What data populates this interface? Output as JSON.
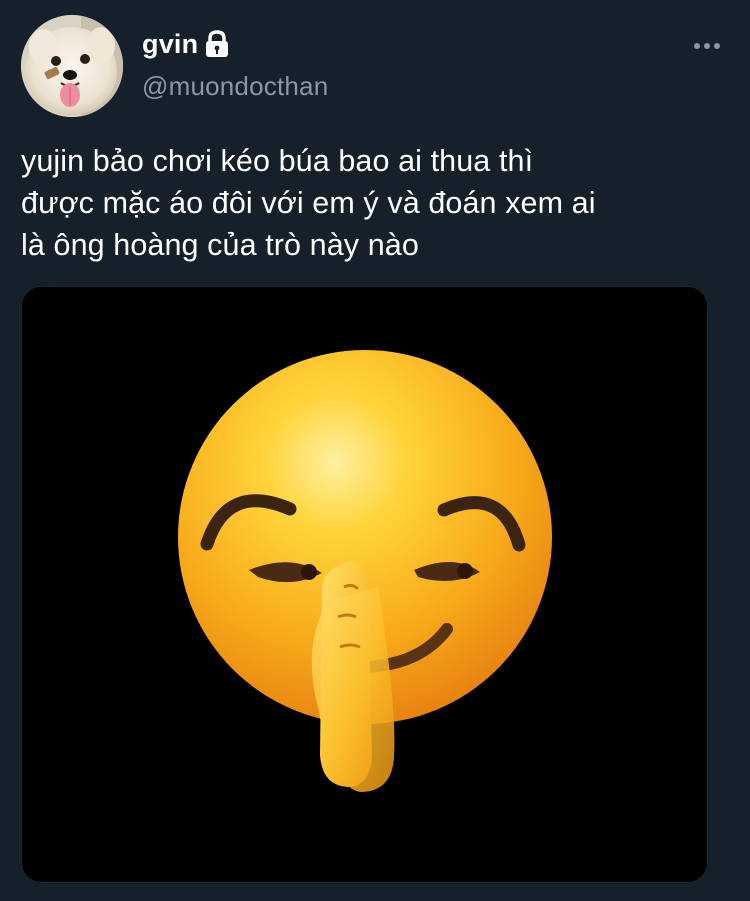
{
  "author": {
    "display_name": "gvin",
    "handle": "@muondocthan",
    "avatar": "white-puppy-photo",
    "protected_icon": "lock-icon"
  },
  "tweet": {
    "text_lines": [
      "yujin bảo chơi kéo búa bao ai thua thì",
      "được mặc áo đôi với em ý và đoán xem ai",
      "là ông hoàng của trò này nào"
    ],
    "media": {
      "icon": "shushing-smirk-emoji",
      "background": "#000000"
    }
  },
  "menu": {
    "icon": "more-dots-icon"
  },
  "colors": {
    "background": "#15202b",
    "primary_text": "#ffffff",
    "secondary_text": "#8899a6"
  }
}
